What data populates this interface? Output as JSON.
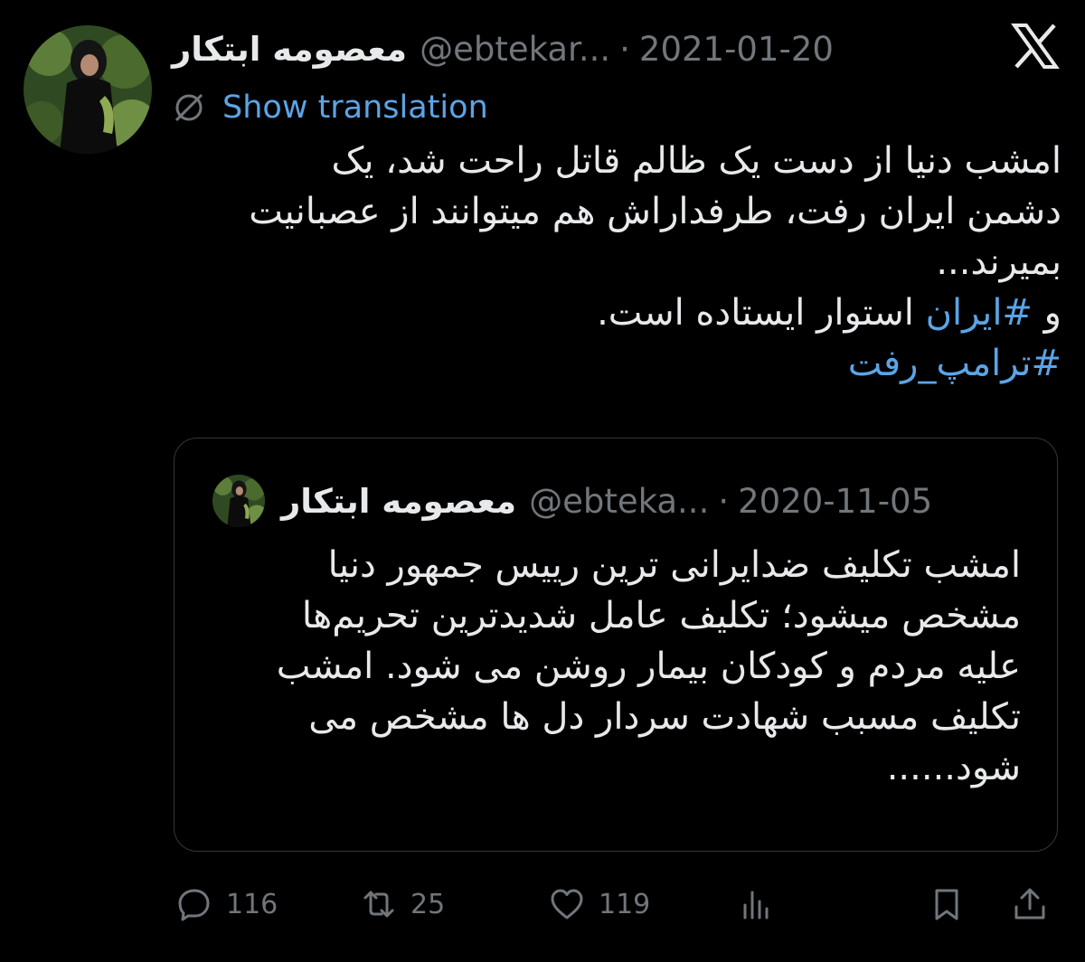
{
  "tweet": {
    "author_name": "معصومه ابتکار",
    "handle": "@ebtekar...",
    "separator": "·",
    "date": "2021-01-20",
    "show_translation": "Show translation",
    "lines": [
      "امشب دنیا از دست یک ظالم قاتل راحت شد، یک",
      "دشمن ایران رفت، طرفداراش هم میتوانند از عصبانیت",
      "بمیرند..."
    ],
    "line4_prefix": "و",
    "line4_hashtag": "#ایران",
    "line4_suffix": "استوار ایستاده است.",
    "hashtag2": "#ترامپ_رفت"
  },
  "quoted": {
    "author_name": "معصومه ابتکار",
    "handle": "@ebteka...",
    "separator": "·",
    "date": "2020-11-05",
    "lines": [
      "امشب تکلیف ضدایرانی ترین رییس جمهور دنیا",
      "مشخص میشود؛ تکلیف عامل شدیدترین تحریم‌ها",
      "علیه مردم و کودکان بیمار روشن می شود. امشب",
      "تکلیف مسبب شهادت سردار دل ها مشخص می",
      "شود......"
    ]
  },
  "actions": {
    "replies": "116",
    "reposts": "25",
    "likes": "119"
  },
  "icons": {
    "logo": "x-logo-icon",
    "translate": "globe-slash-icon",
    "reply": "reply-icon",
    "repost": "repost-icon",
    "like": "heart-icon",
    "views": "views-icon",
    "bookmark": "bookmark-icon",
    "share": "share-icon"
  },
  "colors": {
    "background": "#000000",
    "text": "#e7e9ea",
    "muted": "#71767b",
    "link": "#5ba4e6",
    "border": "#333639"
  }
}
